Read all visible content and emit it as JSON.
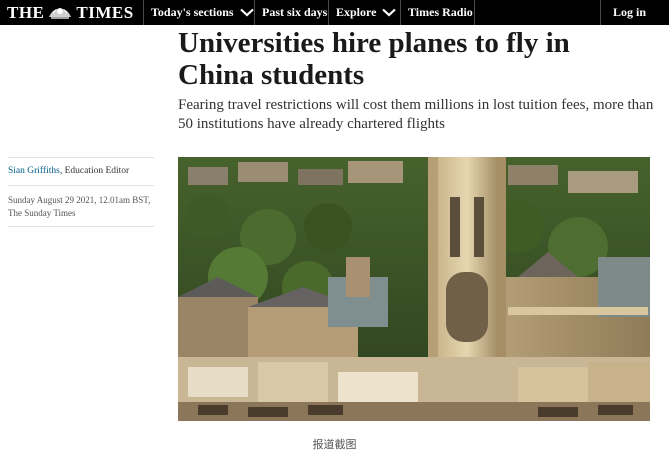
{
  "nav": {
    "logo_left": "THE",
    "logo_right": "TIMES",
    "items": [
      {
        "label": "Today's sections",
        "has_dropdown": true
      },
      {
        "label": "Past six days",
        "has_dropdown": false
      },
      {
        "label": "Explore",
        "has_dropdown": true
      },
      {
        "label": "Times Radio",
        "has_dropdown": false
      }
    ],
    "login_label": "Log in",
    "background_color": "#000000"
  },
  "article": {
    "headline": "Universities hire planes to fly in China students",
    "standfirst": "Fearing travel restrictions will cost them millions in lost tuition fees, more than 50 institutions have already chartered flights",
    "author": "Sian Griffiths",
    "author_role": ", Education Editor",
    "date": "Sunday August 29 2021, 12.01am BST,",
    "publication": "The Sunday Times",
    "author_link_color": "#005c8a"
  },
  "caption": "报道截图"
}
